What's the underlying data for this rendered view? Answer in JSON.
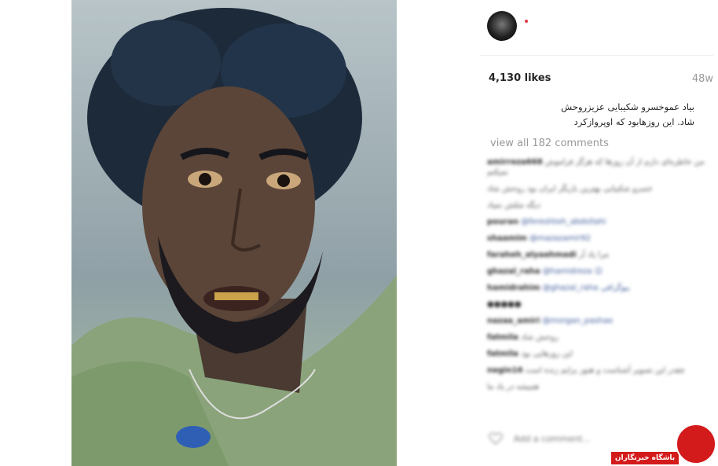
{
  "post": {
    "likes": "4,130 likes",
    "time_ago": "48w",
    "caption_line1": "بیاد عموخسرو شکیبایی عزیزروحش",
    "caption_line2": "شاد. این روزهابود که اوپروازکرد",
    "view_all": "view all 182 comments"
  },
  "comments": [
    {
      "user": "amirreza668",
      "text": "من خاطره‌ای دارم از آن روزها که هرگز فراموش نمیکنم"
    },
    {
      "user": "",
      "text": "خسرو شکیبایی بهترین بازیگر ایران بود روحش شاد"
    },
    {
      "user": "",
      "text": "دیگه مثلش نمیاد"
    },
    {
      "user": "pouran",
      "text": "@fereshteh_abdollahi"
    },
    {
      "user": "shaamim",
      "text": "@mazazamir92"
    },
    {
      "user": "faraheh_alyaahmadi",
      "text": "مرا یاد آر"
    },
    {
      "user": "ghazal_raha",
      "text": "@hamidreza ☺"
    },
    {
      "user": "hamidrahim",
      "text": "@ghazal_raha بیوگرافی"
    },
    {
      "user": "",
      "text": "●●●●●"
    },
    {
      "user": "nazaa_amiri",
      "text": "@morgan_pashae"
    },
    {
      "user": "fatmila",
      "text": "روحش شاد"
    },
    {
      "user": "fatmila",
      "text": "این روزهایی بود"
    },
    {
      "user": "negin16",
      "text": "چقدر این تصویر آشناست و هنوز برایم زنده است"
    },
    {
      "user": "",
      "text": "همیشه در یاد ما"
    }
  ],
  "add_comment": {
    "placeholder": "Add a comment..."
  },
  "watermark": {
    "band_text": "باشگاه خبرنگاران"
  }
}
